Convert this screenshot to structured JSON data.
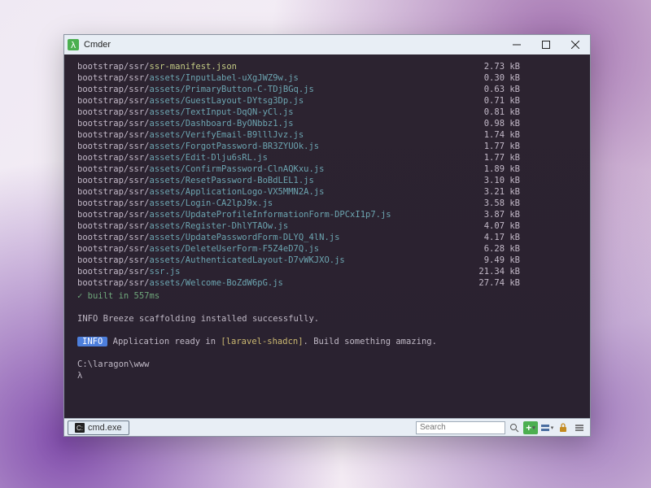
{
  "window": {
    "title": "Cmder"
  },
  "build": {
    "files": [
      {
        "pathBase": "bootstrap/ssr/",
        "pathFile": "ssr-manifest.json",
        "size": "2.73 kB",
        "style": "high"
      },
      {
        "pathBase": "bootstrap/ssr/",
        "pathFile": "assets/InputLabel-uXgJWZ9w.js",
        "size": "0.30 kB",
        "style": "cyan"
      },
      {
        "pathBase": "bootstrap/ssr/",
        "pathFile": "assets/PrimaryButton-C-TDjBGq.js",
        "size": "0.63 kB",
        "style": "cyan"
      },
      {
        "pathBase": "bootstrap/ssr/",
        "pathFile": "assets/GuestLayout-DYtsg3Dp.js",
        "size": "0.71 kB",
        "style": "cyan"
      },
      {
        "pathBase": "bootstrap/ssr/",
        "pathFile": "assets/TextInput-DqQN-yCl.js",
        "size": "0.81 kB",
        "style": "cyan"
      },
      {
        "pathBase": "bootstrap/ssr/",
        "pathFile": "assets/Dashboard-ByONbbz1.js",
        "size": "0.98 kB",
        "style": "cyan"
      },
      {
        "pathBase": "bootstrap/ssr/",
        "pathFile": "assets/VerifyEmail-B9lllJvz.js",
        "size": "1.74 kB",
        "style": "cyan"
      },
      {
        "pathBase": "bootstrap/ssr/",
        "pathFile": "assets/ForgotPassword-BR3ZYUOk.js",
        "size": "1.77 kB",
        "style": "cyan"
      },
      {
        "pathBase": "bootstrap/ssr/",
        "pathFile": "assets/Edit-Dlju6sRL.js",
        "size": "1.77 kB",
        "style": "cyan"
      },
      {
        "pathBase": "bootstrap/ssr/",
        "pathFile": "assets/ConfirmPassword-ClnAQKxu.js",
        "size": "1.89 kB",
        "style": "cyan"
      },
      {
        "pathBase": "bootstrap/ssr/",
        "pathFile": "assets/ResetPassword-BoBdLEL1.js",
        "size": "3.10 kB",
        "style": "cyan"
      },
      {
        "pathBase": "bootstrap/ssr/",
        "pathFile": "assets/ApplicationLogo-VX5MMN2A.js",
        "size": "3.21 kB",
        "style": "cyan"
      },
      {
        "pathBase": "bootstrap/ssr/",
        "pathFile": "assets/Login-CA2lpJ9x.js",
        "size": "3.58 kB",
        "style": "cyan"
      },
      {
        "pathBase": "bootstrap/ssr/",
        "pathFile": "assets/UpdateProfileInformationForm-DPCxI1p7.js",
        "size": "3.87 kB",
        "style": "cyan"
      },
      {
        "pathBase": "bootstrap/ssr/",
        "pathFile": "assets/Register-DhlYTAOw.js",
        "size": "4.07 kB",
        "style": "cyan"
      },
      {
        "pathBase": "bootstrap/ssr/",
        "pathFile": "assets/UpdatePasswordForm-DLYQ_4lN.js",
        "size": "4.17 kB",
        "style": "cyan"
      },
      {
        "pathBase": "bootstrap/ssr/",
        "pathFile": "assets/DeleteUserForm-F5Z4eD7Q.js",
        "size": "6.28 kB",
        "style": "cyan"
      },
      {
        "pathBase": "bootstrap/ssr/",
        "pathFile": "assets/AuthenticatedLayout-D7vWKJXO.js",
        "size": "9.49 kB",
        "style": "cyan"
      },
      {
        "pathBase": "bootstrap/ssr/",
        "pathFile": "ssr.js",
        "size": "21.34 kB",
        "style": "cyan"
      },
      {
        "pathBase": "bootstrap/ssr/",
        "pathFile": "assets/Welcome-BoZdW6pG.js",
        "size": "27.74 kB",
        "style": "cyan"
      }
    ],
    "builtMsg": "✓ built in 557ms",
    "info1": {
      "label": "INFO",
      "text": "Breeze scaffolding installed successfully."
    },
    "info2": {
      "label": "INFO",
      "pre": "Application ready in ",
      "bracket": "[laravel-shadcn]",
      "post": ". Build something amazing."
    },
    "prompt": "C:\\laragon\\www",
    "lambda": "λ"
  },
  "statusbar": {
    "tab": "cmd.exe",
    "searchPlaceholder": "Search"
  }
}
